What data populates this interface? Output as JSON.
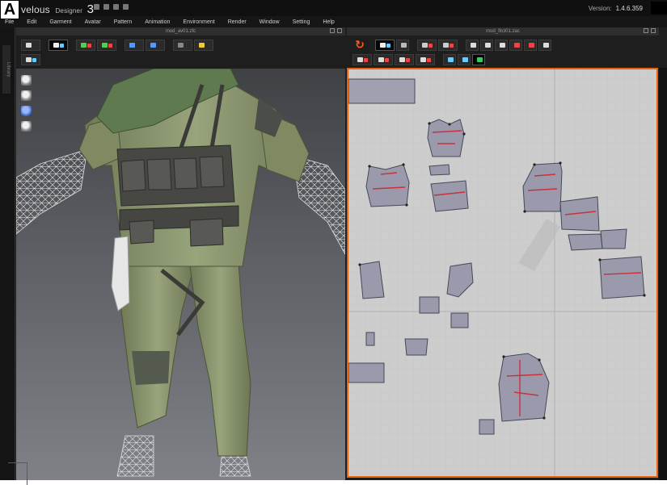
{
  "figure_label": "A",
  "app": {
    "name": "velous",
    "product": "Designer",
    "version": "3",
    "version_label": "Version:",
    "version_number": "1.4.6.359"
  },
  "menu": [
    "File",
    "Edit",
    "Garment",
    "Avatar",
    "Pattern",
    "Animation",
    "Environment",
    "Render",
    "Window",
    "Setting",
    "Help"
  ],
  "panels": {
    "view3d_title": "mod_av01.zfc",
    "view2d_title": "mod_fitcl01.zac",
    "left_gutter_tab": "Library"
  },
  "colors": {
    "accent_border": "#e8620f",
    "garment": "#8b9771",
    "pattern_fill": "#9a9aac",
    "stitch_red": "#c8323a",
    "sync_icon": "#ff5a1e"
  },
  "icons": {
    "sync": "sync-icon",
    "side_tools": [
      "avatar-front-icon",
      "avatar-side-icon",
      "avatar-back-icon",
      "avatar-head-icon"
    ]
  }
}
